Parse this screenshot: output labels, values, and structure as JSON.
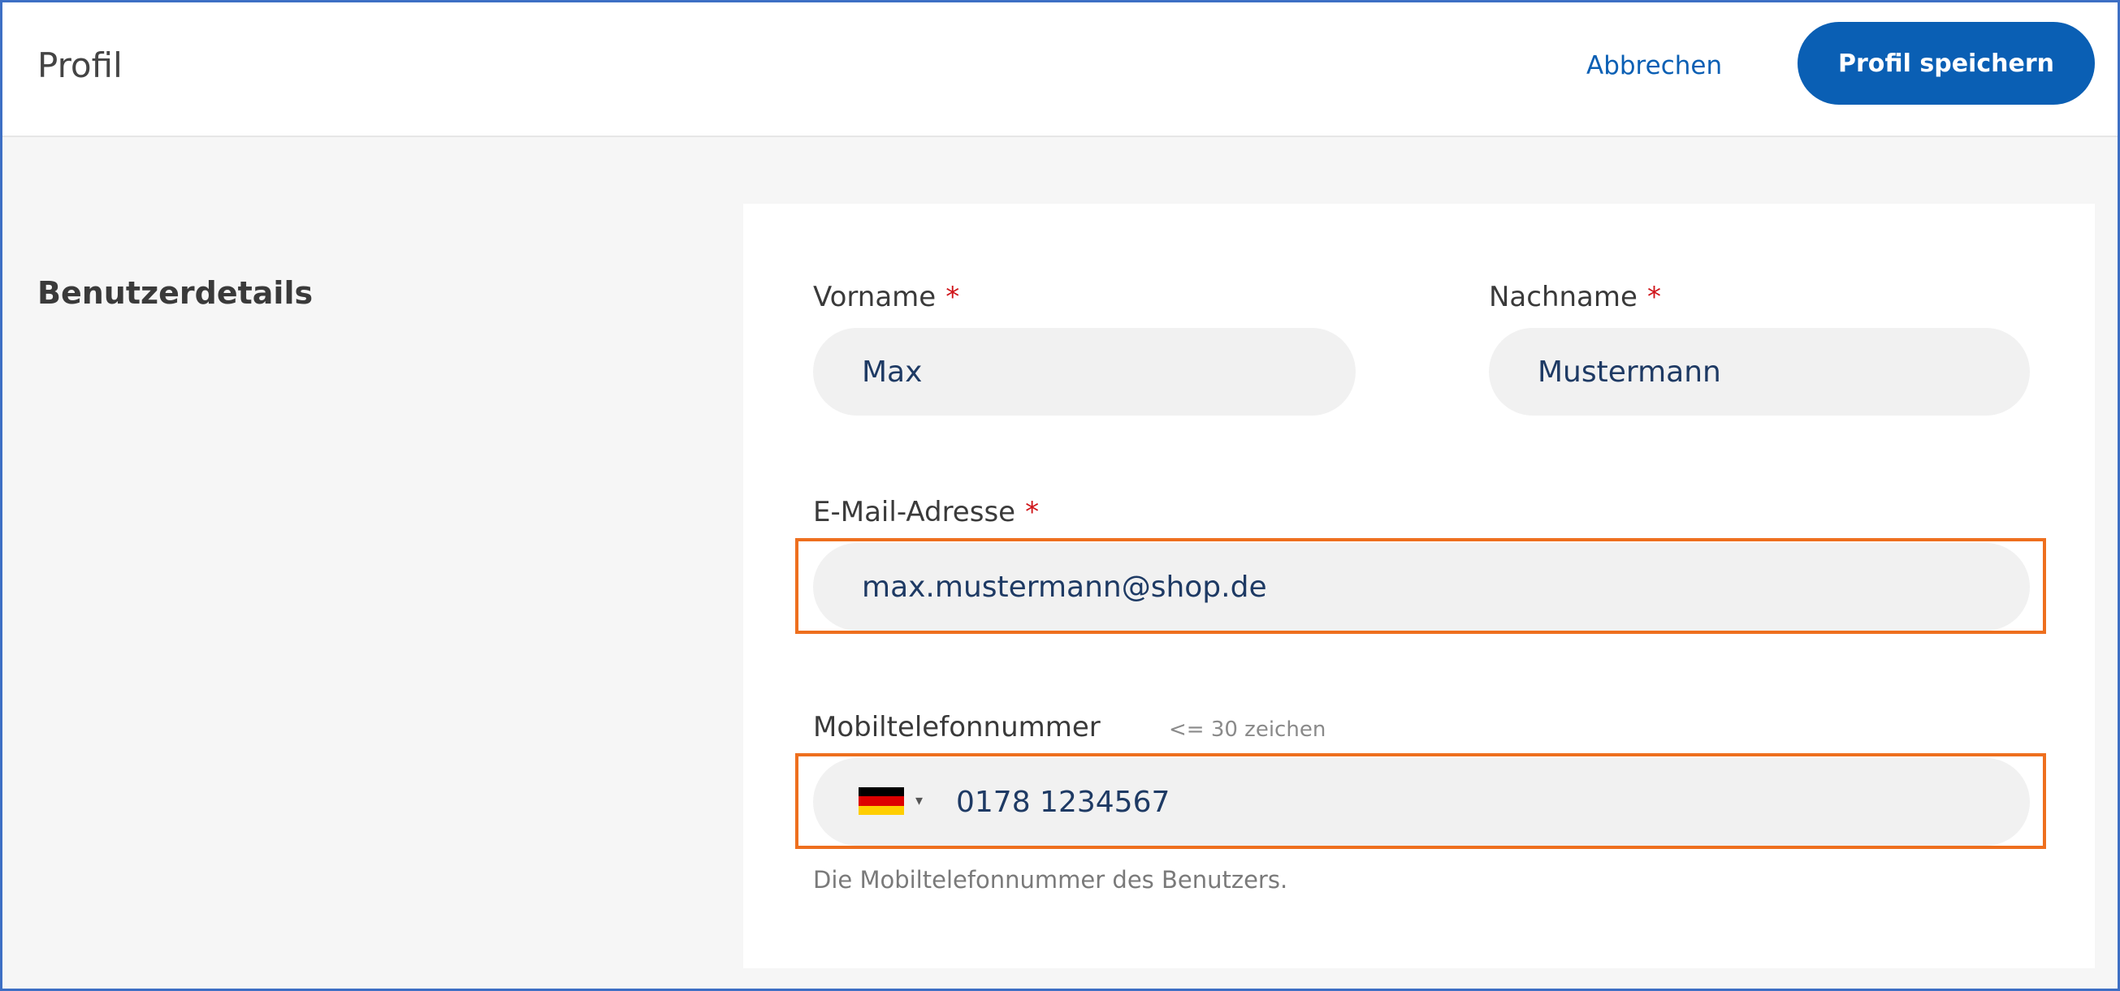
{
  "header": {
    "title": "Profil",
    "cancel_label": "Abbrechen",
    "save_label": "Profil speichern"
  },
  "section": {
    "title": "Benutzerdetails"
  },
  "form": {
    "required_marker": "*",
    "first_name": {
      "label": "Vorname",
      "value": "Max"
    },
    "last_name": {
      "label": "Nachname",
      "value": "Mustermann"
    },
    "email": {
      "label": "E-Mail-Adresse",
      "value": "max.mustermann@shop.de"
    },
    "mobile": {
      "label": "Mobiltelefonnummer",
      "hint": "<= 30 zeichen",
      "country_icon": "germany-flag-icon",
      "value": "0178 1234567",
      "helper": "Die Mobiltelefonnummer des Benutzers."
    }
  },
  "colors": {
    "primary": "#0a5fb4",
    "required": "#d0161b",
    "highlight": "#ee6f1e",
    "field_bg": "#f1f1f1",
    "page_bg": "#f6f6f6"
  }
}
